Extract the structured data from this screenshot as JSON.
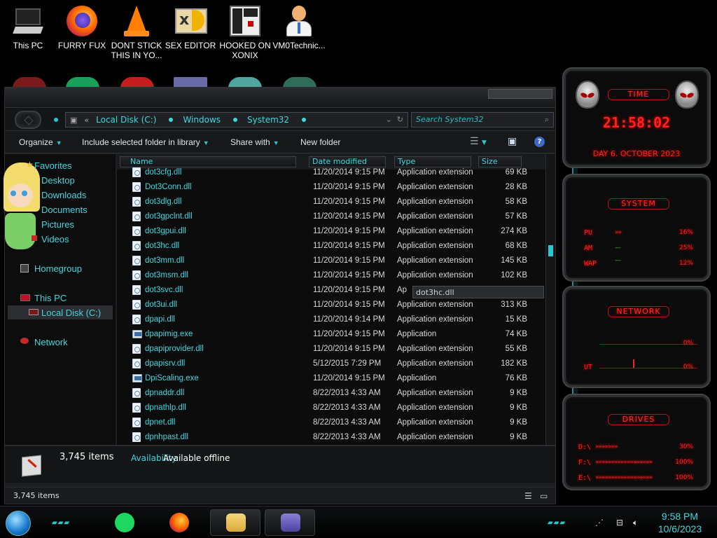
{
  "desktop": {
    "icons": [
      {
        "label": "This PC"
      },
      {
        "label": "FURRY FUX"
      },
      {
        "label": "DONT STICK THIS IN YO..."
      },
      {
        "label": "SEX EDITOR"
      },
      {
        "label": "HOOKED ON XONIX"
      },
      {
        "label": "VM0Technic..."
      }
    ]
  },
  "explorer": {
    "address": {
      "back": "«",
      "crumbs": [
        "Local Disk (C:)",
        "Windows",
        "System32"
      ]
    },
    "search": {
      "placeholder": "Search System32"
    },
    "toolbar": {
      "organize": "Organize",
      "include": "Include selected folder in library",
      "share": "Share with",
      "new_folder": "New folder",
      "help": "?"
    },
    "nav": {
      "favorites": "Favorites",
      "desktop": "Desktop",
      "downloads": "Downloads",
      "documents": "Documents",
      "pictures": "Pictures",
      "videos": "Videos",
      "homegroup": "Homegroup",
      "this_pc": "This PC",
      "local_disk": "Local Disk (C:)",
      "network": "Network"
    },
    "columns": {
      "name": "Name",
      "date": "Date modified",
      "type": "Type",
      "size": "Size"
    },
    "rows": [
      {
        "name": "dot3cfg.dll",
        "date": "11/20/2014 9:15 PM",
        "type": "Application extension",
        "size": "69 KB"
      },
      {
        "name": "Dot3Conn.dll",
        "date": "11/20/2014 9:15 PM",
        "type": "Application extension",
        "size": "28 KB"
      },
      {
        "name": "dot3dlg.dll",
        "date": "11/20/2014 9:15 PM",
        "type": "Application extension",
        "size": "58 KB"
      },
      {
        "name": "dot3gpclnt.dll",
        "date": "11/20/2014 9:15 PM",
        "type": "Application extension",
        "size": "57 KB"
      },
      {
        "name": "dot3gpui.dll",
        "date": "11/20/2014 9:15 PM",
        "type": "Application extension",
        "size": "274 KB"
      },
      {
        "name": "dot3hc.dll",
        "date": "11/20/2014 9:15 PM",
        "type": "Application extension",
        "size": "68 KB"
      },
      {
        "name": "dot3mm.dll",
        "date": "11/20/2014 9:15 PM",
        "type": "Application extension",
        "size": "145 KB"
      },
      {
        "name": "dot3msm.dll",
        "date": "11/20/2014 9:15 PM",
        "type": "Application extension",
        "size": "102 KB"
      },
      {
        "name": "dot3svc.dll",
        "date": "11/20/2014 9:15 PM",
        "type": "Ap",
        "size": ""
      },
      {
        "name": "dot3ui.dll",
        "date": "11/20/2014 9:15 PM",
        "type": "Application extension",
        "size": "313 KB"
      },
      {
        "name": "dpapi.dll",
        "date": "11/20/2014 9:14 PM",
        "type": "Application extension",
        "size": "15 KB"
      },
      {
        "name": "dpapimig.exe",
        "date": "11/20/2014 9:15 PM",
        "type": "Application",
        "size": "74 KB"
      },
      {
        "name": "dpapiprovider.dll",
        "date": "11/20/2014 9:15 PM",
        "type": "Application extension",
        "size": "55 KB"
      },
      {
        "name": "dpapisrv.dll",
        "date": "5/12/2015 7:29 PM",
        "type": "Application extension",
        "size": "182 KB"
      },
      {
        "name": "DpiScaling.exe",
        "date": "11/20/2014 9:15 PM",
        "type": "Application",
        "size": "76 KB"
      },
      {
        "name": "dpnaddr.dll",
        "date": "8/22/2013 4:33 AM",
        "type": "Application extension",
        "size": "9 KB"
      },
      {
        "name": "dpnathlp.dll",
        "date": "8/22/2013 4:33 AM",
        "type": "Application extension",
        "size": "9 KB"
      },
      {
        "name": "dpnet.dll",
        "date": "8/22/2013 4:33 AM",
        "type": "Application extension",
        "size": "9 KB"
      },
      {
        "name": "dpnhpast.dll",
        "date": "8/22/2013 4:33 AM",
        "type": "Application extension",
        "size": "9 KB"
      }
    ],
    "tooltip": "dot3hc.dll",
    "details": {
      "count": "3,745 items",
      "availability_label": "Availability:",
      "availability_value": "Available offline"
    },
    "status": "3,745 items"
  },
  "gadgets": {
    "time": {
      "title": "TIME",
      "clock": "21:58:02",
      "date": "DAY 6. OCTOBER 2023"
    },
    "system": {
      "title": "SYSTEM",
      "rows": [
        {
          "label": "PU",
          "value": "16%"
        },
        {
          "label": "AM",
          "value": "25%"
        },
        {
          "label": "WAP",
          "value": "12%"
        }
      ]
    },
    "network": {
      "title": "NETWORK",
      "rows": [
        {
          "label": "",
          "value": "0%"
        },
        {
          "label": "UT",
          "value": "0%"
        }
      ]
    },
    "drives": {
      "title": "DRIVES",
      "rows": [
        {
          "label": "D:\\",
          "value": "30%"
        },
        {
          "label": "F:\\",
          "value": "100%"
        },
        {
          "label": "E:\\",
          "value": "100%"
        }
      ]
    }
  },
  "taskbar": {
    "time": "9:58 PM",
    "date": "10/6/2023"
  },
  "colors": {
    "accent": "#3fd7dd",
    "alert": "#ff2020",
    "window": "#1e1f22"
  }
}
